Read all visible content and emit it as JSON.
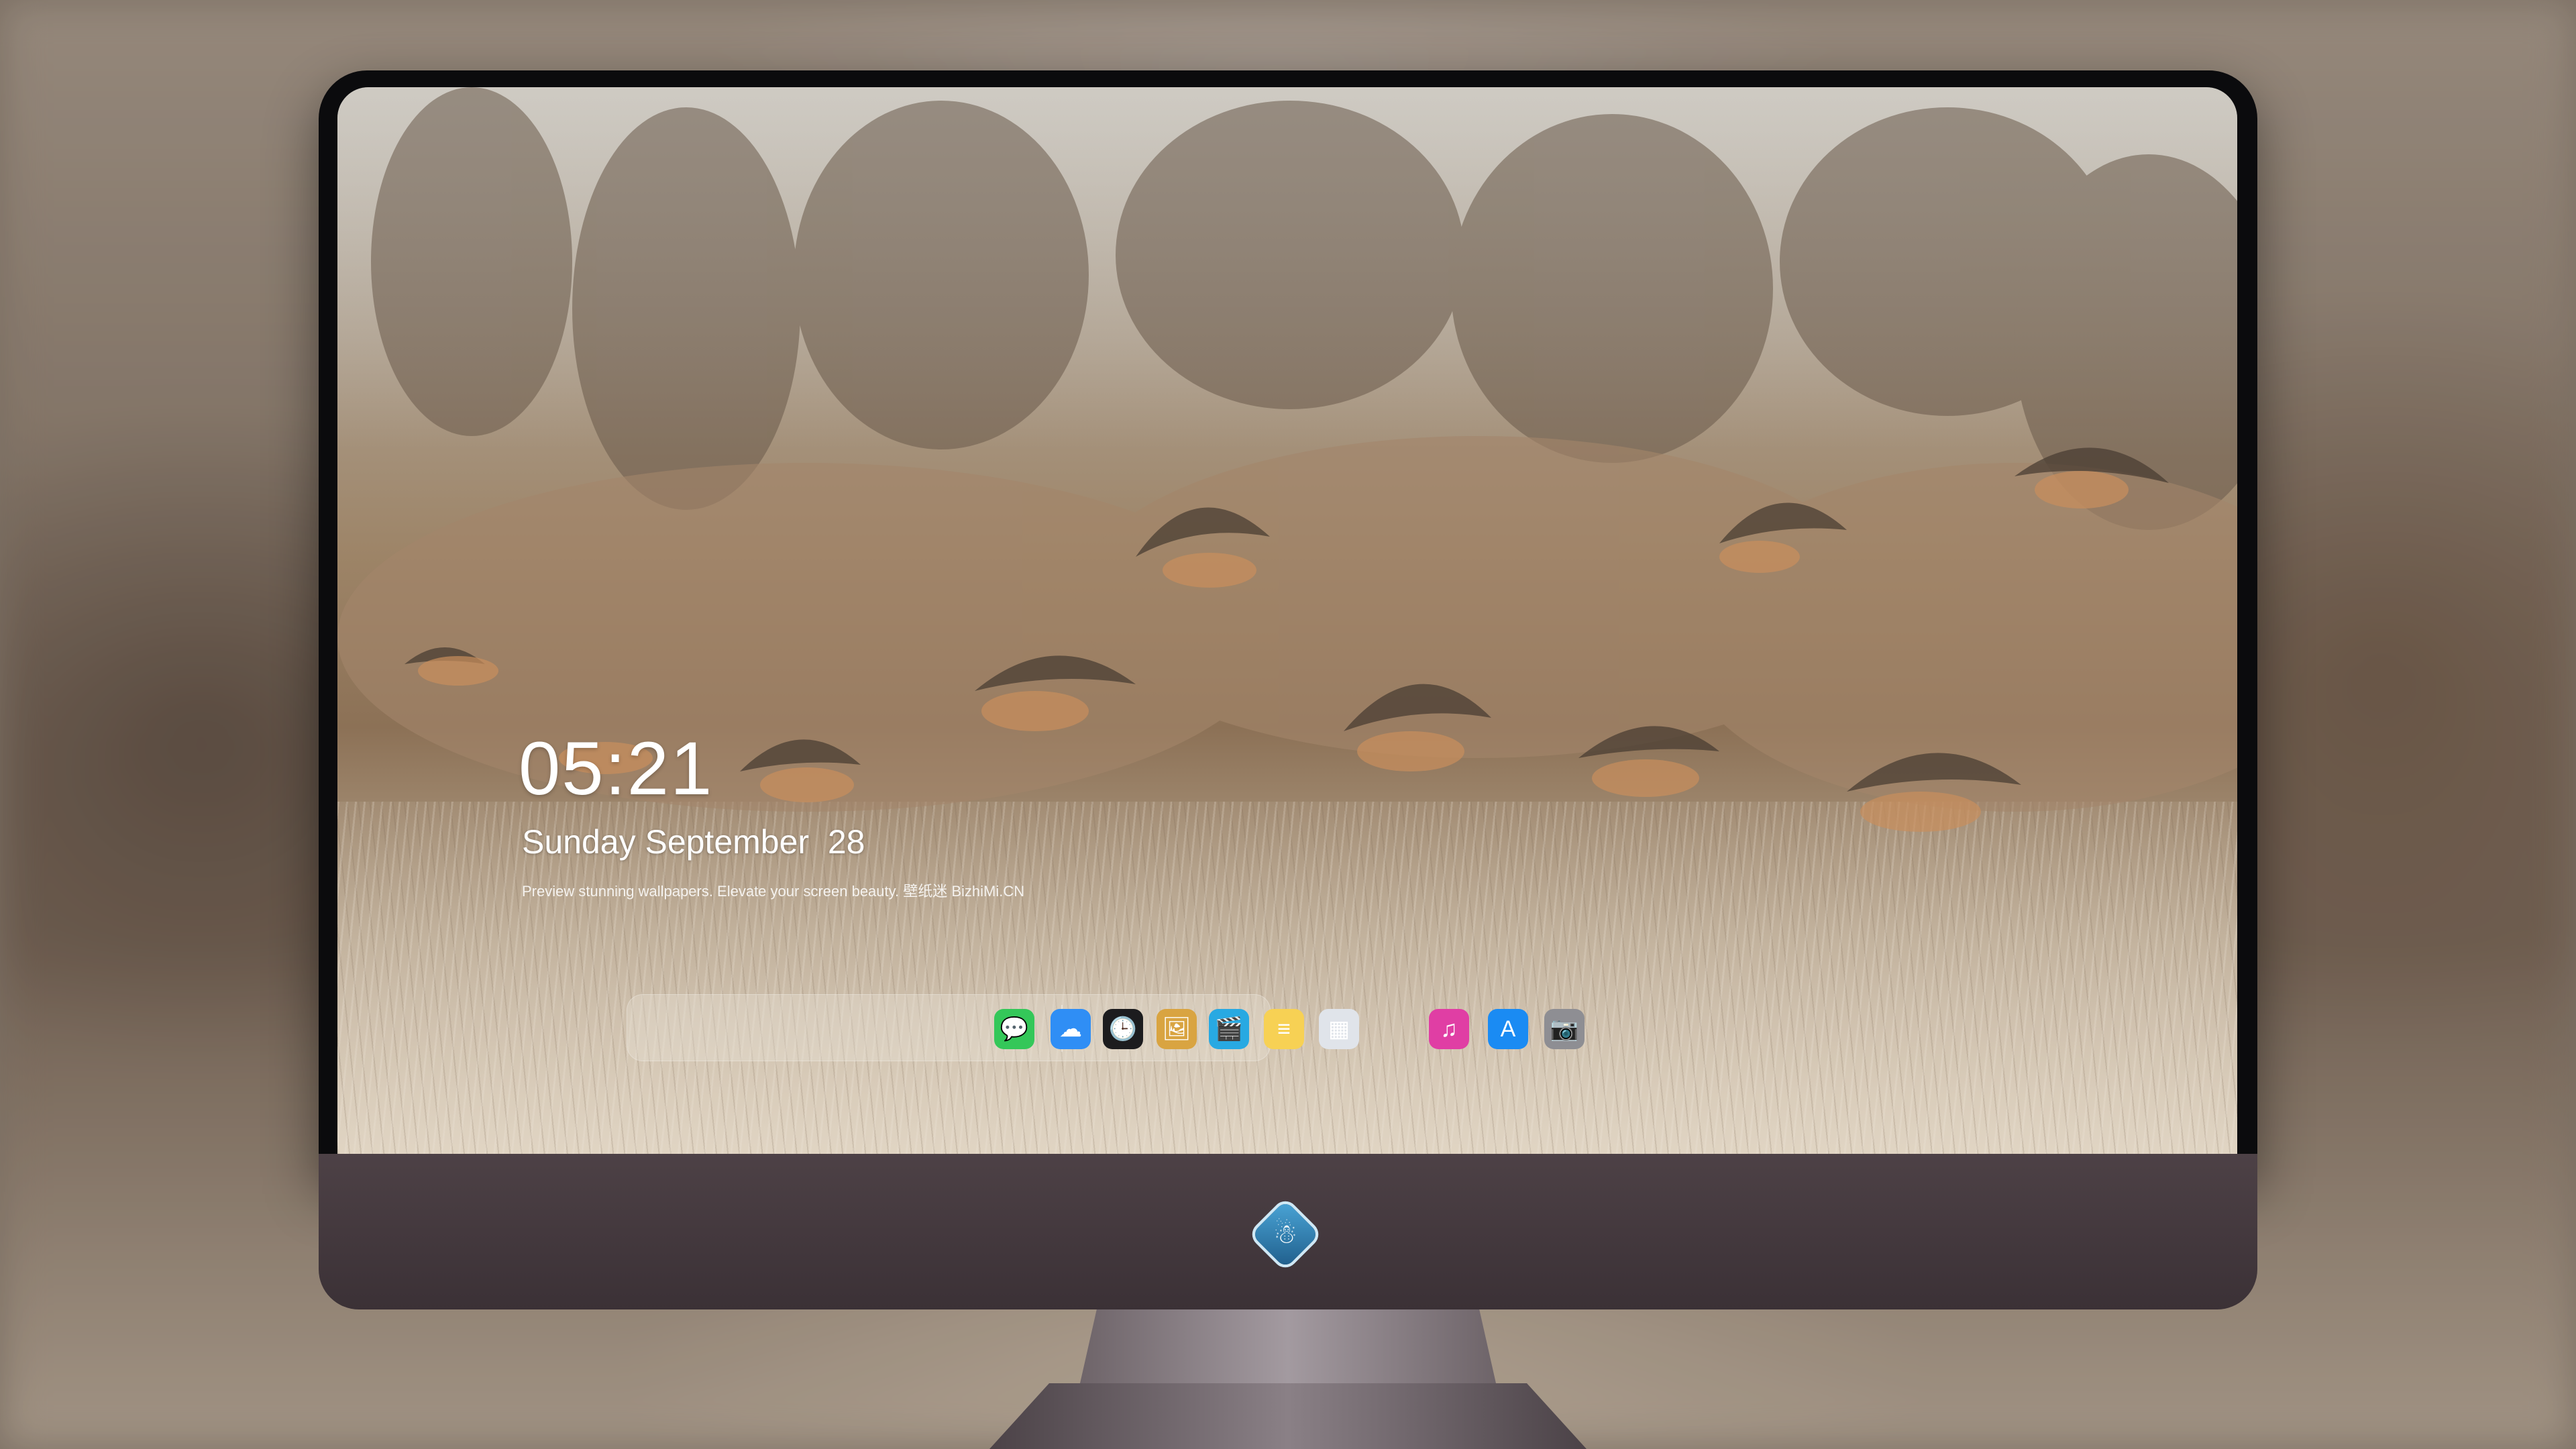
{
  "lockscreen": {
    "time": "05:21",
    "date": "Sunday September  28",
    "caption": "Preview stunning wallpapers. Elevate your screen beauty. 壁纸迷 BizhiMi.CN"
  },
  "dock": {
    "items": [
      {
        "name": "messages-icon",
        "glyph": "💬",
        "color": "#34c759"
      },
      {
        "name": "weather-icon",
        "glyph": "☁",
        "color": "#2f8ef5"
      },
      {
        "name": "clock-icon",
        "glyph": "🕒",
        "color": "#1c1c1e"
      },
      {
        "name": "preview-icon",
        "glyph": "🖼",
        "color": "#d9a441"
      },
      {
        "name": "clips-icon",
        "glyph": "🎬",
        "color": "#28a9e2"
      },
      {
        "name": "notes-icon",
        "glyph": "≡",
        "color": "#f7d154"
      },
      {
        "name": "photo-collage-icon",
        "glyph": "▦",
        "color": "#e0e4ea"
      },
      {
        "name": "music-icon",
        "glyph": "♫",
        "color": "#e03ea4"
      },
      {
        "name": "app-store-icon",
        "glyph": "A",
        "color": "#1a8bf3"
      },
      {
        "name": "camera-icon",
        "glyph": "📷",
        "color": "#8e8e93"
      }
    ]
  },
  "monitor": {
    "logo": "☃"
  }
}
